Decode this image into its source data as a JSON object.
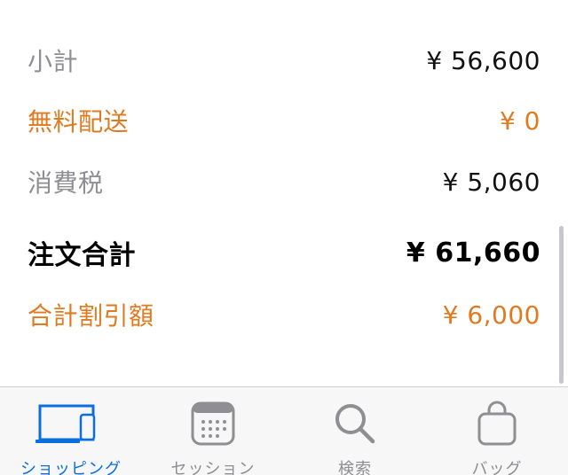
{
  "summary": {
    "subtotal": {
      "label": "小計",
      "value": "¥ 56,600"
    },
    "free_shipping": {
      "label": "無料配送",
      "value": "¥ 0"
    },
    "tax": {
      "label": "消費税",
      "value": "¥ 5,060"
    },
    "order_total": {
      "label": "注文合計",
      "value": "¥ 61,660"
    },
    "discount_total": {
      "label": "合計割引額",
      "value": "¥ 6,000"
    }
  },
  "colors": {
    "accent_orange": "#e07a1f",
    "active_blue": "#0b6ee0",
    "inactive_gray": "#8e8e93"
  },
  "tabbar": {
    "tabs": [
      {
        "label": "ショッピング",
        "icon": "devices-icon",
        "active": true
      },
      {
        "label": "セッション",
        "icon": "calendar-icon",
        "active": false
      },
      {
        "label": "検索",
        "icon": "search-icon",
        "active": false
      },
      {
        "label": "バッグ",
        "icon": "bag-icon",
        "active": false
      }
    ]
  }
}
